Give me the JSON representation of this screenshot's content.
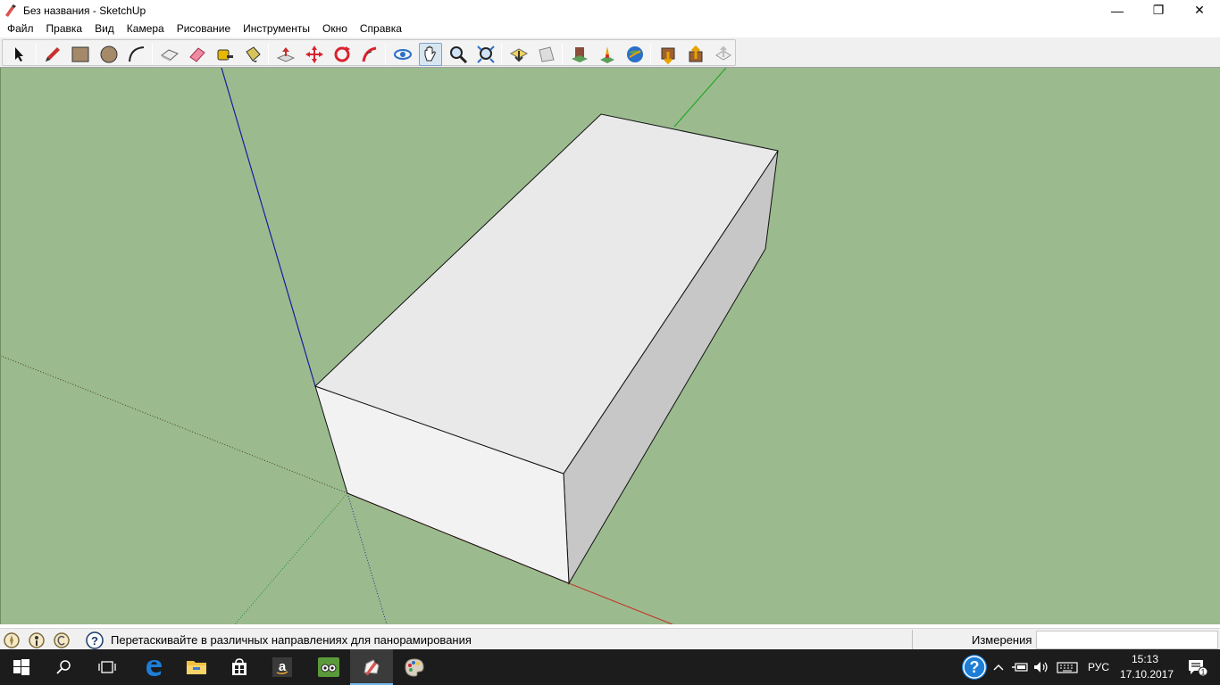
{
  "window": {
    "title": "Без названия - SketchUp",
    "controls": {
      "minimize": "—",
      "restore": "❐",
      "close": "✕"
    }
  },
  "menu": [
    "Файл",
    "Правка",
    "Вид",
    "Камера",
    "Рисование",
    "Инструменты",
    "Окно",
    "Справка"
  ],
  "toolbar": {
    "tools": [
      {
        "name": "select-tool",
        "icon": "arrow-cursor-icon"
      },
      {
        "name": "line-tool",
        "icon": "pencil-icon"
      },
      {
        "name": "rectangle-tool",
        "icon": "rectangle-icon"
      },
      {
        "name": "circle-tool",
        "icon": "circle-icon"
      },
      {
        "name": "arc-tool",
        "icon": "arc-icon"
      },
      {
        "name": "make-component-tool",
        "icon": "component-icon"
      },
      {
        "name": "eraser-tool",
        "icon": "eraser-icon"
      },
      {
        "name": "tape-measure-tool",
        "icon": "tape-measure-icon"
      },
      {
        "name": "paint-bucket-tool",
        "icon": "paint-bucket-icon"
      },
      {
        "name": "push-pull-tool",
        "icon": "push-pull-icon"
      },
      {
        "name": "move-tool",
        "icon": "move-icon"
      },
      {
        "name": "rotate-tool",
        "icon": "rotate-icon"
      },
      {
        "name": "follow-me-tool",
        "icon": "follow-me-icon"
      },
      {
        "name": "orbit-tool",
        "icon": "orbit-icon"
      },
      {
        "name": "pan-tool",
        "icon": "hand-icon"
      },
      {
        "name": "zoom-tool",
        "icon": "magnifier-icon"
      },
      {
        "name": "zoom-extents-tool",
        "icon": "zoom-extents-icon"
      },
      {
        "name": "previous-view-tool",
        "icon": "previous-view-icon"
      },
      {
        "name": "next-view-tool",
        "icon": "next-view-icon"
      },
      {
        "name": "warehouse-tool",
        "icon": "warehouse-icon"
      },
      {
        "name": "add-location-tool",
        "icon": "location-pin-icon"
      },
      {
        "name": "google-earth-tool",
        "icon": "globe-icon"
      },
      {
        "name": "get-models-tool",
        "icon": "get-models-icon"
      },
      {
        "name": "share-model-tool",
        "icon": "share-model-icon"
      },
      {
        "name": "share-component-tool",
        "icon": "share-component-icon"
      }
    ],
    "active_tool": "pan-tool"
  },
  "statusbar": {
    "hint": "Перетаскивайте в различных направлениях для панорамирования",
    "measurements_label": "Измерения",
    "measurements_value": ""
  },
  "taskbar": {
    "apps": [
      {
        "name": "start-button",
        "icon": "windows-logo-icon"
      },
      {
        "name": "search-button",
        "icon": "search-icon"
      },
      {
        "name": "task-view-button",
        "icon": "task-view-icon"
      },
      {
        "name": "edge-button",
        "icon": "edge-icon"
      },
      {
        "name": "explorer-button",
        "icon": "folder-icon"
      },
      {
        "name": "store-button",
        "icon": "store-icon"
      },
      {
        "name": "amazon-button",
        "icon": "amazon-icon"
      },
      {
        "name": "tripadvisor-button",
        "icon": "tripadvisor-icon"
      },
      {
        "name": "sketchup-button",
        "icon": "sketchup-icon"
      },
      {
        "name": "paint-button",
        "icon": "palette-icon"
      }
    ],
    "language": "РУС",
    "time": "15:13",
    "date": "17.10.2017",
    "notification_count": "1"
  },
  "colors": {
    "ground": "#9bbb8f",
    "axis_red": "#c0392b",
    "axis_green": "#27a527",
    "axis_blue": "#1a1aa0",
    "box_top": "#e9e9e9",
    "box_front": "#f2f2f2",
    "box_side": "#c5c5c5"
  }
}
